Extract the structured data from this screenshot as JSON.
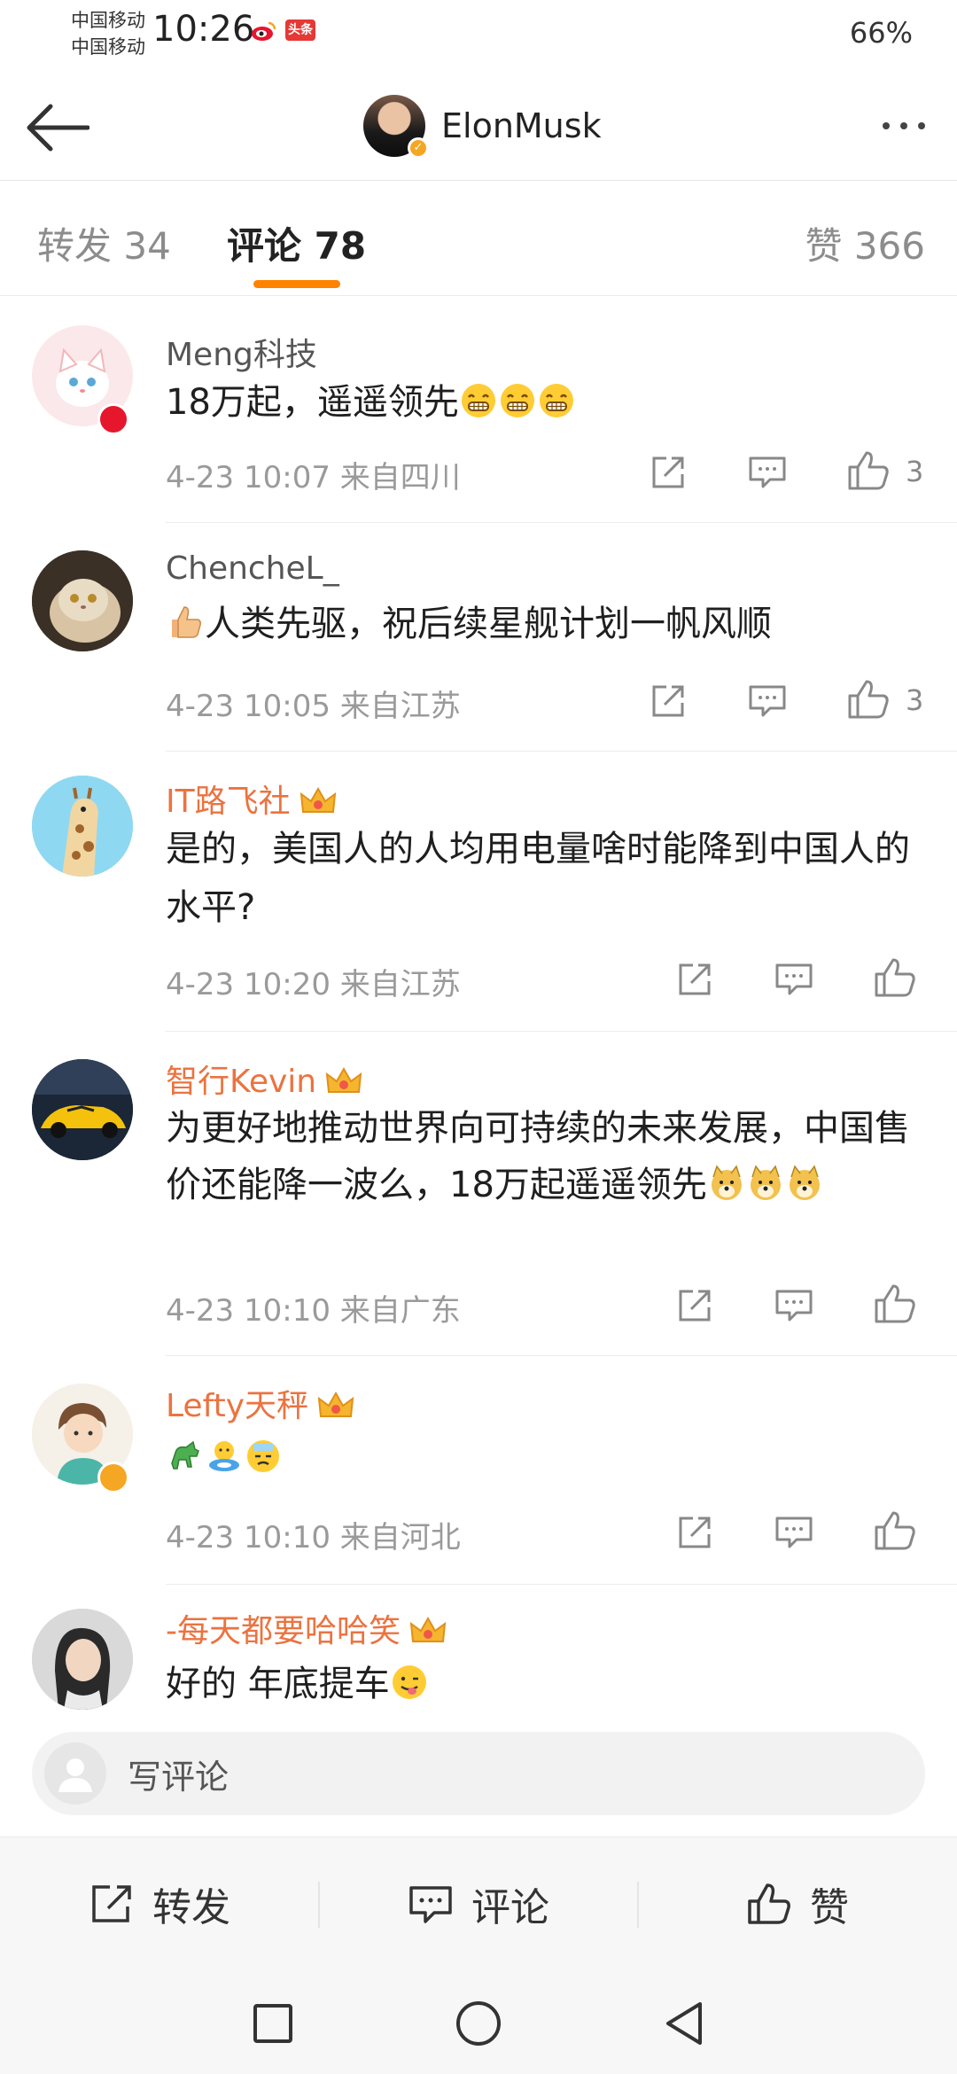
{
  "status_bar": {
    "carrier_1": "中国移动",
    "carrier_2": "中国移动",
    "time": "10:26",
    "app_badge": "头条",
    "battery": "66%"
  },
  "header": {
    "author_name": "ElonMusk",
    "back_icon": "arrow-left-icon",
    "more_icon": "more-dots-icon"
  },
  "tabs": [
    {
      "label": "转发 34",
      "active": false
    },
    {
      "label": "评论 78",
      "active": true
    },
    {
      "label": "赞 366",
      "active": false
    }
  ],
  "accent_color": "#ff8200",
  "vip_name_color": "#eb7340",
  "comments": [
    {
      "user": "Meng科技",
      "text": "18万起，遥遥领先",
      "emojis": [
        "grin",
        "grin",
        "grin"
      ],
      "time": "4-23 10:07",
      "location": "来自四川",
      "likes": "3"
    },
    {
      "user": "ChencheL_",
      "text": "人类先驱，祝后续星舰计划一帆风顺",
      "lead_emoji": "thumbs-up",
      "time": "4-23 10:05",
      "location": "来自江苏",
      "likes": "3"
    },
    {
      "user": "IT路飞社",
      "text": "是的，美国人的人均用电量啥时能降到中国人的水平?",
      "time": "4-23 10:20",
      "location": "来自江苏",
      "likes": ""
    },
    {
      "user": "智行Kevin",
      "text": "为更好地推动世界向可持续的未来发展，中国售价还能降一波么，18万起遥遥领先",
      "emojis": [
        "doge",
        "doge",
        "doge"
      ],
      "time": "4-23 10:10",
      "location": "来自广东",
      "likes": ""
    },
    {
      "user": "Lefty天秤",
      "text": "",
      "emojis": [
        "horse",
        "swim",
        "sweat"
      ],
      "time": "4-23 10:10",
      "location": "来自河北",
      "likes": ""
    },
    {
      "user": "-每天都要哈哈笑",
      "text": "好的 年底提车",
      "emojis": [
        "tongue"
      ],
      "time": "",
      "location": "",
      "likes": ""
    }
  ],
  "input": {
    "placeholder": "写评论"
  },
  "actions": {
    "repost": "转发",
    "comment": "评论",
    "like": "赞"
  }
}
